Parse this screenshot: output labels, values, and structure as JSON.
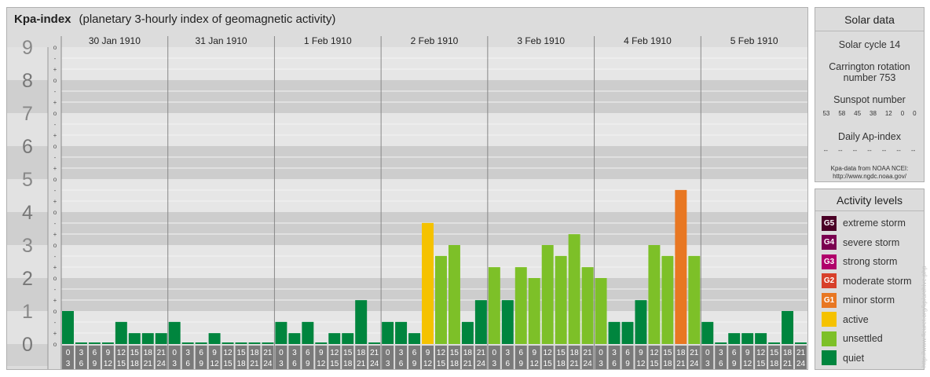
{
  "header": {
    "title": "Kpa-index",
    "subtitle": "(planetary 3-hourly index of geomagnetic activity)"
  },
  "chart_data": {
    "type": "bar",
    "title": "Kpa-index",
    "subtitle": "(planetary 3-hourly index of geomagnetic activity)",
    "ylim": [
      0,
      9
    ],
    "y_major_ticks": [
      "0",
      "1",
      "2",
      "3",
      "4",
      "5",
      "6",
      "7",
      "8",
      "9"
    ],
    "y_minor_ticks": [
      "-",
      "o",
      "+"
    ],
    "days": [
      "30 Jan 1910",
      "31 Jan 1910",
      "1 Feb 1910",
      "2 Feb 1910",
      "3 Feb 1910",
      "4 Feb 1910",
      "5 Feb 1910"
    ],
    "interval_labels": [
      [
        "0",
        "3"
      ],
      [
        "3",
        "6"
      ],
      [
        "6",
        "9"
      ],
      [
        "9",
        "12"
      ],
      [
        "12",
        "15"
      ],
      [
        "15",
        "18"
      ],
      [
        "18",
        "21"
      ],
      [
        "21",
        "24"
      ]
    ],
    "values": [
      [
        1.0,
        0.0,
        0.0,
        0.0,
        0.67,
        0.33,
        0.33,
        0.33
      ],
      [
        0.67,
        0.0,
        0.0,
        0.33,
        0.0,
        0.0,
        0.0,
        0.0
      ],
      [
        0.67,
        0.33,
        0.67,
        0.0,
        0.33,
        0.33,
        1.33,
        0.0
      ],
      [
        0.67,
        0.67,
        0.33,
        3.67,
        2.67,
        3.0,
        0.67,
        1.33
      ],
      [
        2.33,
        1.33,
        2.33,
        2.0,
        3.0,
        2.67,
        3.33,
        2.33
      ],
      [
        2.0,
        0.67,
        0.67,
        1.33,
        3.0,
        2.67,
        4.67,
        2.67
      ],
      [
        0.67,
        0.0,
        0.33,
        0.33,
        0.33,
        0.0,
        1.0,
        0.0
      ]
    ],
    "color_levels": {
      "quiet": "#00853e",
      "unsettled": "#7dc028",
      "active": "#f5c200",
      "minor_storm": "#e87722"
    },
    "grid": true
  },
  "solar": {
    "heading": "Solar data",
    "cycle": "Solar cycle 14",
    "carrington_line1": "Carrington rotation",
    "carrington_line2": "number 753",
    "sunspot_heading": "Sunspot number",
    "sunspot_values": [
      "53",
      "58",
      "45",
      "38",
      "12",
      "0",
      "0"
    ],
    "ap_heading": "Daily Ap-index",
    "ap_values": [
      "--",
      "--",
      "--",
      "--",
      "--",
      "--",
      "--"
    ],
    "credit_line1": "Kpa-data from NOAA NCEI:",
    "credit_line2": "http://www.ngdc.noaa.gov/"
  },
  "activity": {
    "heading": "Activity levels",
    "levels": [
      {
        "code": "G5",
        "label": "extreme storm",
        "color": "#4a0026"
      },
      {
        "code": "G4",
        "label": "severe storm",
        "color": "#7a0050"
      },
      {
        "code": "G3",
        "label": "strong storm",
        "color": "#b0006a"
      },
      {
        "code": "G2",
        "label": "moderate storm",
        "color": "#d7402a"
      },
      {
        "code": "G1",
        "label": "minor storm",
        "color": "#e87722"
      },
      {
        "code": "",
        "label": "active",
        "color": "#f5c200"
      },
      {
        "code": "",
        "label": "unsettled",
        "color": "#7dc028"
      },
      {
        "code": "",
        "label": "quiet",
        "color": "#00853e"
      }
    ]
  },
  "vertical_credit": "http://www.fleuret.org/kp/archive.php"
}
